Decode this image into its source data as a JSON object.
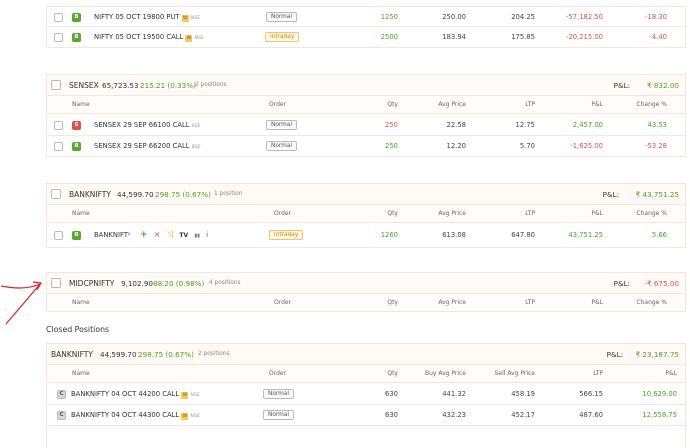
{
  "open_rows_top": [
    {
      "side": "B",
      "name": "NIFTY 05 OCT 19800 PUT",
      "weekly": "W",
      "exchange": "NSE",
      "order": "Normal",
      "qty": "1250",
      "avg": "250.00",
      "ltp": "204.25",
      "pnl": "-57,182.50",
      "change": "-18.30"
    },
    {
      "side": "B",
      "name": "NIFTY 05 OCT 19500 CALL",
      "weekly": "W",
      "exchange": "NSE",
      "order": "Intraday",
      "qty": "2500",
      "avg": "183.94",
      "ltp": "175.85",
      "pnl": "-20,215.00",
      "change": "-4.40"
    }
  ],
  "columns": {
    "name": "Name",
    "order": "Order",
    "qty": "Qty",
    "avg": "Avg Price",
    "ltp": "LTP",
    "pnl": "P&L",
    "change": "Change %"
  },
  "sensex": {
    "title": "SENSEX",
    "price": "65,723.53",
    "change": "215.21 (0.33%)",
    "count": "2 positions",
    "pnl_label": "P&L:",
    "pnl_value": "₹ 832.00",
    "rows": [
      {
        "side": "S",
        "name": "SENSEX 29 SEP 66100 CALL",
        "exchange": "BSE",
        "order": "Normal",
        "qty": "250",
        "avg": "22.58",
        "ltp": "12.75",
        "pnl": "2,457.00",
        "change": "43.53"
      },
      {
        "side": "B",
        "name": "SENSEX 29 SEP 66200 CALL",
        "exchange": "BSE",
        "order": "Normal",
        "qty": "250",
        "avg": "12.20",
        "ltp": "5.70",
        "pnl": "-1,625.00",
        "change": "-53.28"
      }
    ]
  },
  "banknifty": {
    "title": "BANKNIFTY",
    "price": "44,599.70",
    "change": "298.75 (0.67%)",
    "count": "1 position",
    "pnl_label": "P&L:",
    "pnl_value": "₹ 43,751.25",
    "rows": [
      {
        "side": "B",
        "name": "BANKNIFTʸ",
        "order": "Intraday",
        "qty": "1260",
        "avg": "613.08",
        "ltp": "647.80",
        "pnl": "43,751.25",
        "change": "5.66"
      }
    ],
    "actions": [
      "+",
      "×",
      "⤨",
      "TV",
      "▮▮",
      "i"
    ]
  },
  "midcpnifty": {
    "title": "MIDCPNIFTY",
    "price": "9,102.90",
    "change": "88.20 (0.98%)",
    "count": "4 positions",
    "pnl_label": "P&L:",
    "pnl_value": "-₹ 675.00"
  },
  "closed": {
    "section_title": "Closed Positions",
    "title": "BANKNIFTY",
    "price": "44,599.70",
    "change": "298.75 (0.67%)",
    "count": "2 positions",
    "pnl_label": "P&L:",
    "pnl_value": "₹ 23,187.75",
    "columns": {
      "name": "Name",
      "order": "Order",
      "qty": "Qty",
      "buy_avg": "Buy Avg Price",
      "sell_avg": "Sell Avg Price",
      "ltp": "LTP",
      "pnl": "P&L"
    },
    "rows": [
      {
        "side": "C",
        "name": "BANKNIFTY 04 OCT 44200 CALL",
        "weekly": "W",
        "exchange": "NSE",
        "order": "Normal",
        "qty": "630",
        "buy_avg": "441.32",
        "sell_avg": "458.19",
        "ltp": "566.15",
        "pnl": "10,629.00"
      },
      {
        "side": "C",
        "name": "BANKNIFTY 04 OCT 44300 CALL",
        "weekly": "W",
        "exchange": "NSE",
        "order": "Normal",
        "qty": "630",
        "buy_avg": "432.23",
        "sell_avg": "452.17",
        "ltp": "487.60",
        "pnl": "12,558.75"
      }
    ]
  },
  "colors": {
    "profit": "#4da22a",
    "loss": "#d9534f",
    "intraday": "#d08a00",
    "annotation": "#e02020"
  }
}
